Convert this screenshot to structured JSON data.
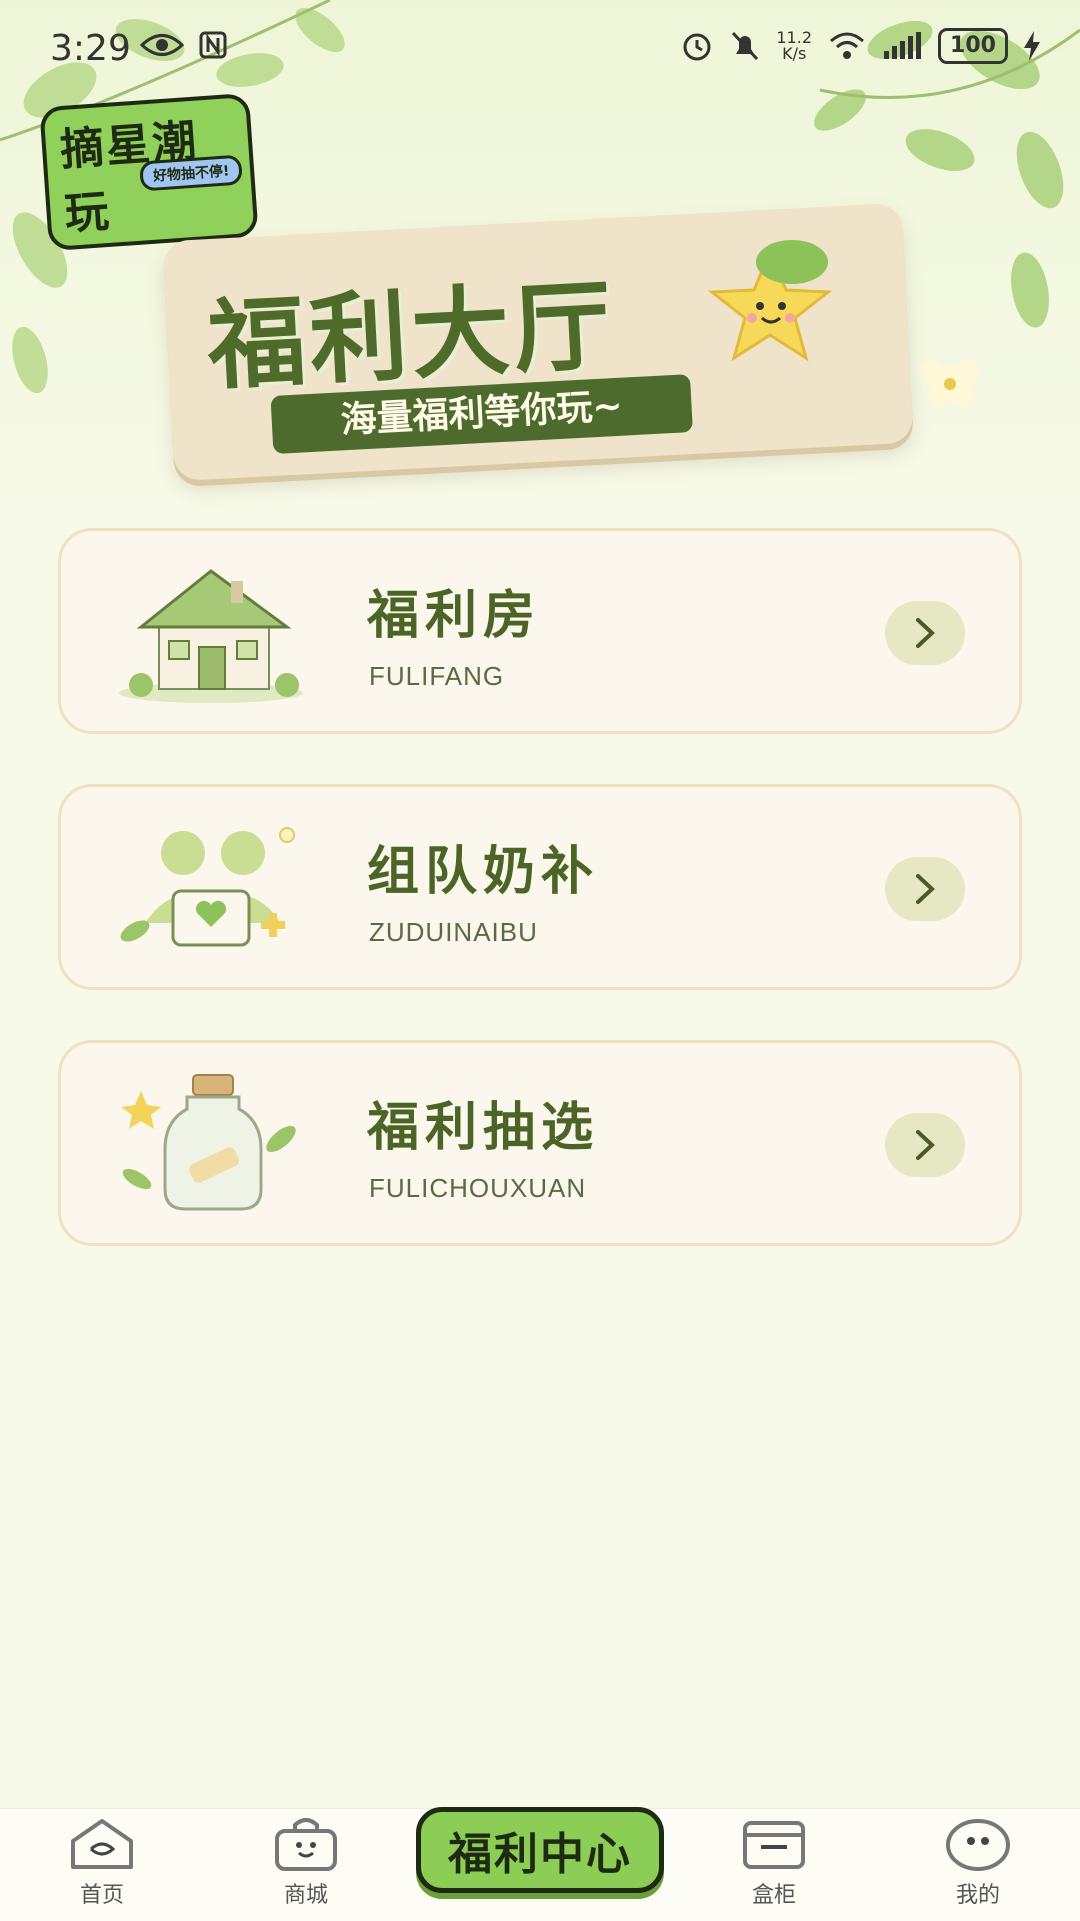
{
  "status_bar": {
    "time": "3:29",
    "network_speed_value": "11.2",
    "network_speed_unit": "K/s",
    "battery": "100"
  },
  "logo": {
    "main": "摘星潮玩",
    "tagline": "好物抽不停!"
  },
  "banner": {
    "title": "福利大厅",
    "subtitle": "海量福利等你玩~"
  },
  "cards": [
    {
      "title": "福利房",
      "subtitle": "FULIFANG",
      "icon": "house-icon"
    },
    {
      "title": "组队奶补",
      "subtitle": "ZUDUINAIBU",
      "icon": "team-icon"
    },
    {
      "title": "福利抽选",
      "subtitle": "FULICHOUXUAN",
      "icon": "jar-icon"
    }
  ],
  "bottom_nav": {
    "items": [
      {
        "label": "首页",
        "icon": "home-icon"
      },
      {
        "label": "商城",
        "icon": "shop-bag-icon"
      },
      {
        "label": "福利中心",
        "icon": "welfare-center-badge"
      },
      {
        "label": "盒柜",
        "icon": "box-cabinet-icon"
      },
      {
        "label": "我的",
        "icon": "profile-face-icon"
      }
    ]
  },
  "colors": {
    "background": "#f7fae8",
    "title_green": "#4a6526",
    "card_bg": "#fbf7ec",
    "card_border": "#efe2c2",
    "accent_green": "#8ccd55"
  }
}
